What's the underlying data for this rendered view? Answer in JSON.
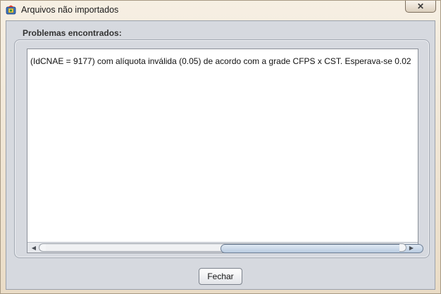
{
  "window": {
    "title": "Arquivos não importados",
    "close_icon": "✕"
  },
  "panel": {
    "label": "Problemas encontrados:"
  },
  "messages": {
    "line1": "(IdCNAE = 9177) com alíquota inválida (0.05) de acordo com a grade CFPS x CST. Esperava-se 0.02"
  },
  "scrollbar": {
    "left_arrow": "◀",
    "right_arrow": "▶"
  },
  "buttons": {
    "close_label": "Fechar"
  }
}
